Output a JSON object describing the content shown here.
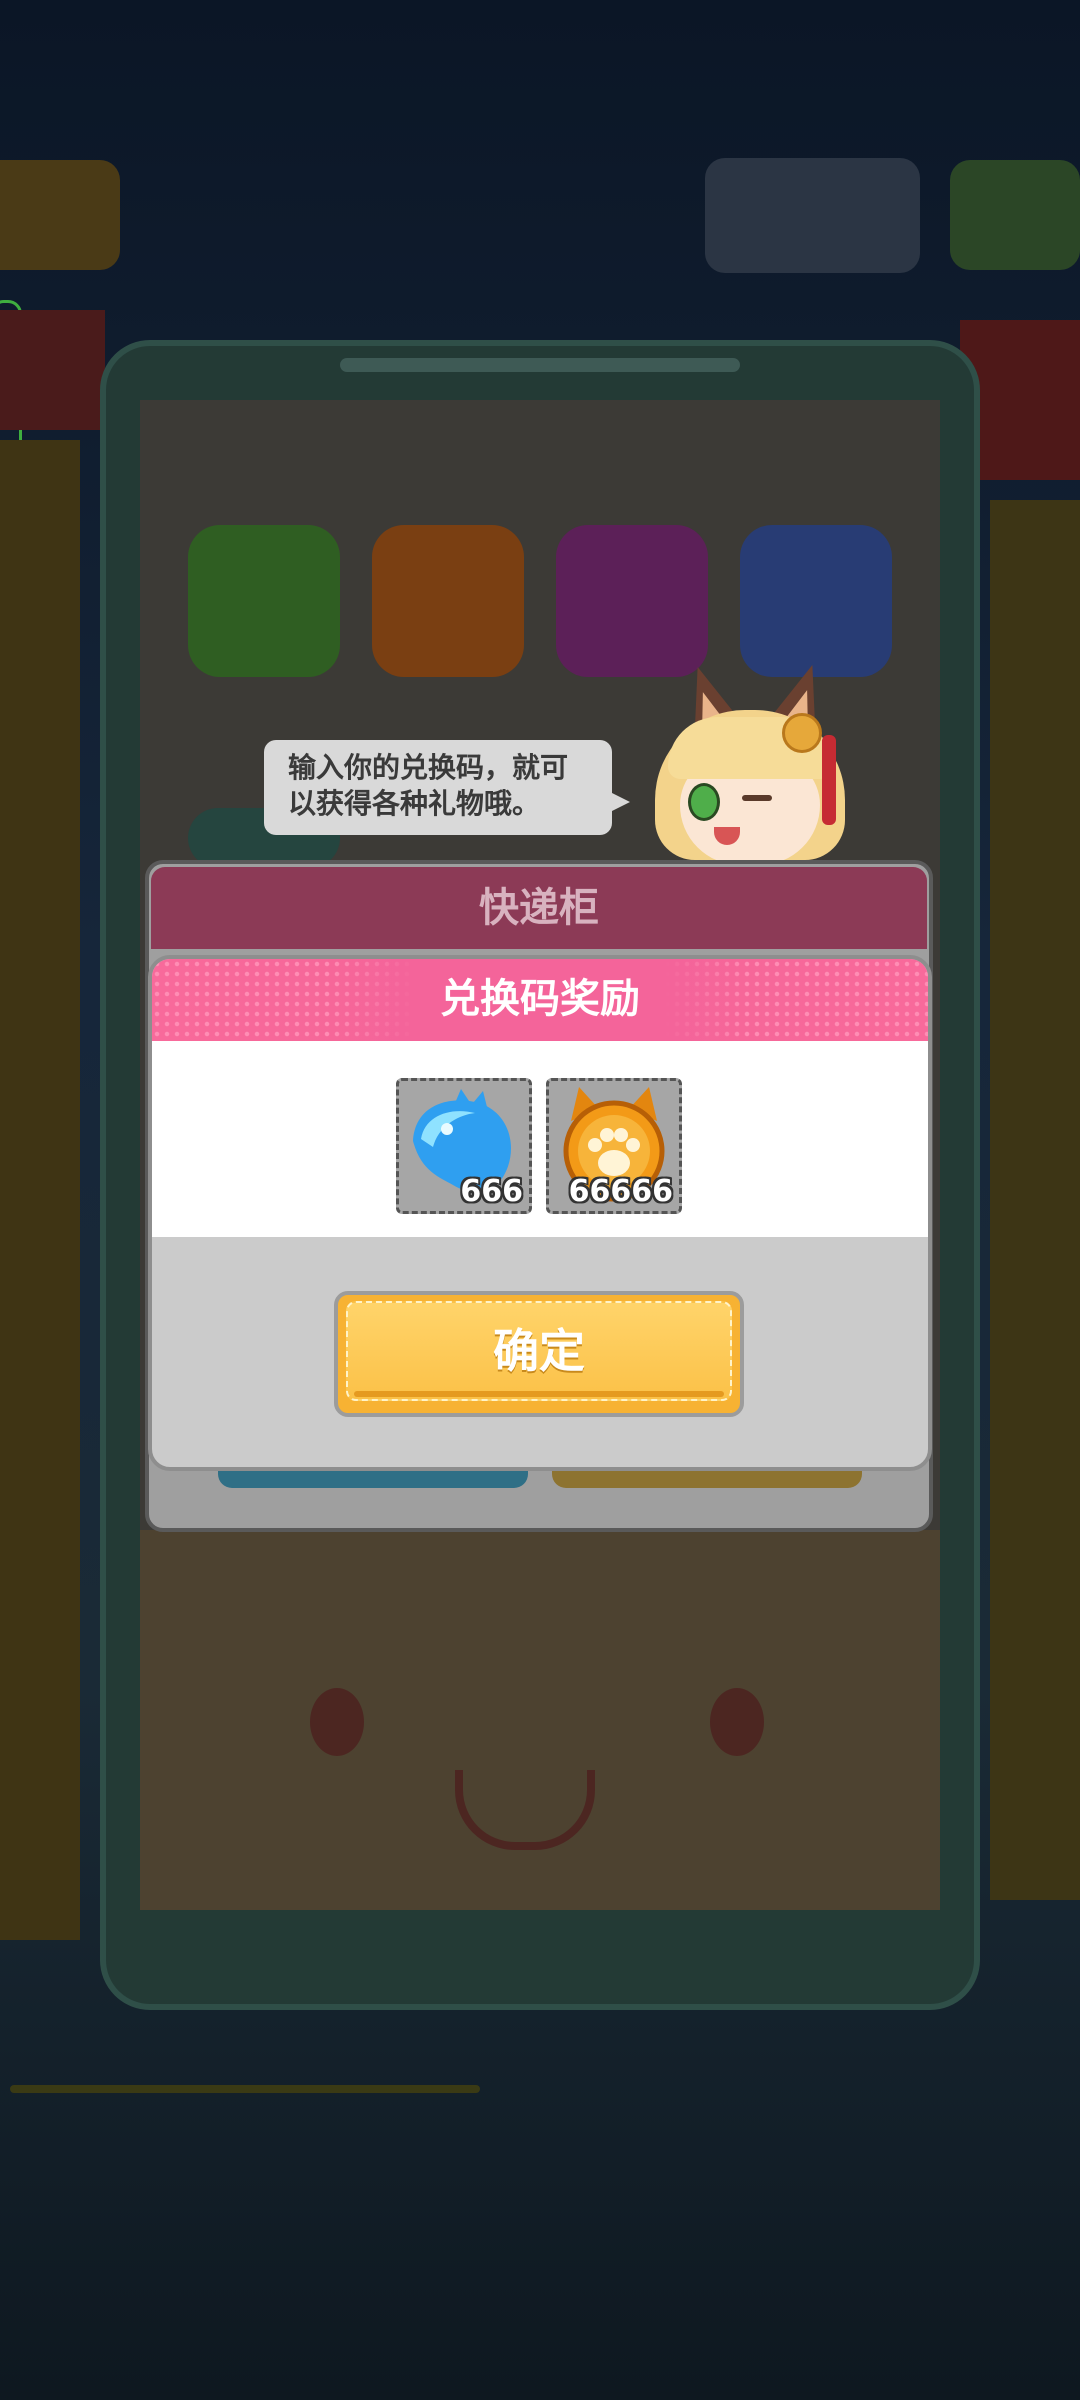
{
  "speech_bubble": {
    "text_line1": "输入你的兑换码，就可",
    "text_line2": "以获得各种礼物哦。"
  },
  "back_dialog": {
    "title": "快递柜"
  },
  "reward_dialog": {
    "title": "兑换码奖励",
    "items": [
      {
        "icon": "blue-gem-icon",
        "count": "666"
      },
      {
        "icon": "paw-coin-icon",
        "count": "66666"
      }
    ],
    "confirm_label": "确定"
  },
  "colors": {
    "header_pink": "#f4649a",
    "confirm_yellow": "#fbc148",
    "back_header": "#8c3a56"
  }
}
